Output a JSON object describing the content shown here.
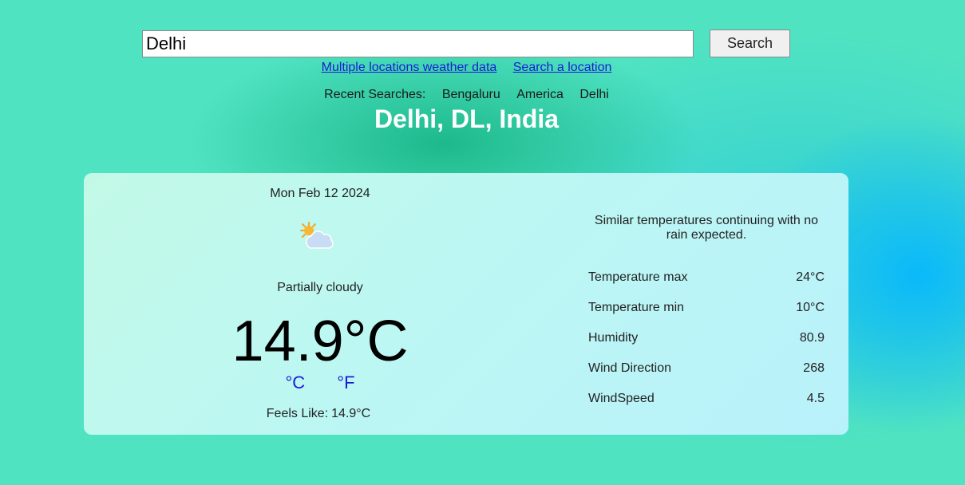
{
  "search": {
    "value": "Delhi",
    "button_label": "Search"
  },
  "links": {
    "multiple": "Multiple locations weather data",
    "search_location": "Search a location"
  },
  "recent": {
    "label": "Recent Searches:",
    "items": [
      "Bengaluru",
      "America",
      "Delhi"
    ]
  },
  "location": "Delhi, DL, India",
  "card": {
    "date": "Mon Feb 12 2024",
    "icon": "partly-cloudy-icon",
    "condition": "Partially cloudy",
    "temperature": "14.9°C",
    "units": {
      "celsius": "°C",
      "fahrenheit": "°F"
    },
    "feels_like_label": "Feels Like:",
    "feels_like_value": "14.9°C",
    "summary": "Similar temperatures continuing with no rain expected.",
    "stats": [
      {
        "label": "Temperature max",
        "value": "24°C"
      },
      {
        "label": "Temperature min",
        "value": "10°C"
      },
      {
        "label": "Humidity",
        "value": "80.9"
      },
      {
        "label": "Wind Direction",
        "value": "268"
      },
      {
        "label": "WindSpeed",
        "value": "4.5"
      }
    ]
  },
  "colors": {
    "background": "#50e3c2",
    "title": "#ffffff",
    "link": "#1b1bd6"
  }
}
